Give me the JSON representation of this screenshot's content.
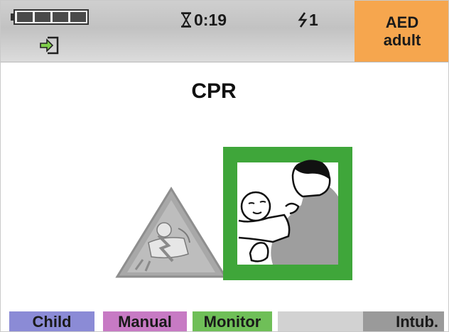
{
  "status_bar": {
    "battery_segments": 4,
    "battery_charged_segments": 4,
    "timer_text": "0:19",
    "shock_count_text": "1",
    "mode_line1": "AED",
    "mode_line2": "adult",
    "icons": [
      "battery-icon",
      "plug-in-icon",
      "hourglass-icon",
      "lightning-bolt-icon"
    ]
  },
  "main": {
    "prompt_title": "CPR"
  },
  "softkeys": {
    "child": "Child",
    "manual": "Manual",
    "monitor": "Monitor",
    "empty": "",
    "intub": "Intub."
  },
  "colors": {
    "status_bar_bg": "#c8c8c8",
    "mode_box_bg": "#f6a64e",
    "cpr_frame_green": "#3fa63a",
    "warning_triangle_gray": "#a8a8a8",
    "softkey_child": "#8b8bd6",
    "softkey_manual": "#c77ac4",
    "softkey_monitor": "#6fbf58",
    "softkey_empty": "#d2d2d2",
    "softkey_intub": "#9a9a9a"
  }
}
